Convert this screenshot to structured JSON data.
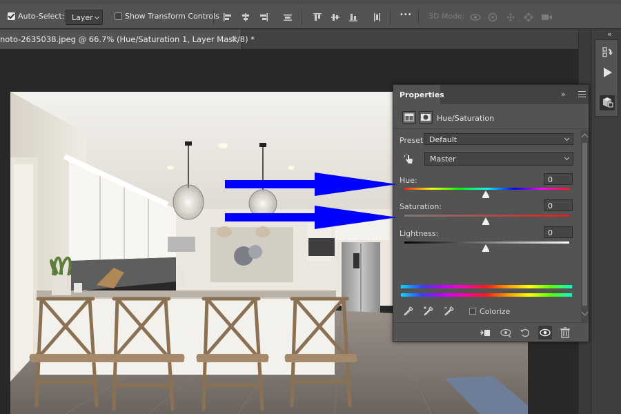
{
  "options_bar": {
    "auto_select_label": "Auto-Select:",
    "auto_select_checked": true,
    "auto_select_target": "Layer",
    "show_transform_label": "Show Transform Controls",
    "show_transform_checked": false,
    "more_label": "•••",
    "mode_3d_label": "3D Mode:"
  },
  "document": {
    "tab_title": "noto-2635038.jpeg @ 66.7% (Hue/Saturation 1, Layer Mask/8) *",
    "close_glyph": "×"
  },
  "dock": {
    "collapse_glyph": "«"
  },
  "properties": {
    "tab_label": "Properties",
    "expand_glyph": "»",
    "adjustment_title": "Hue/Saturation",
    "preset_label": "Preset:",
    "preset_value": "Default",
    "channel_value": "Master",
    "hue_label": "Hue:",
    "hue_value": "0",
    "saturation_label": "Saturation:",
    "saturation_value": "0",
    "lightness_label": "Lightness:",
    "lightness_value": "0",
    "colorize_label": "Colorize",
    "colorize_checked": false
  },
  "colors": {
    "accent_arrow": "#0000ff",
    "panel_bg": "#535353",
    "canvas_bg": "#282828"
  }
}
